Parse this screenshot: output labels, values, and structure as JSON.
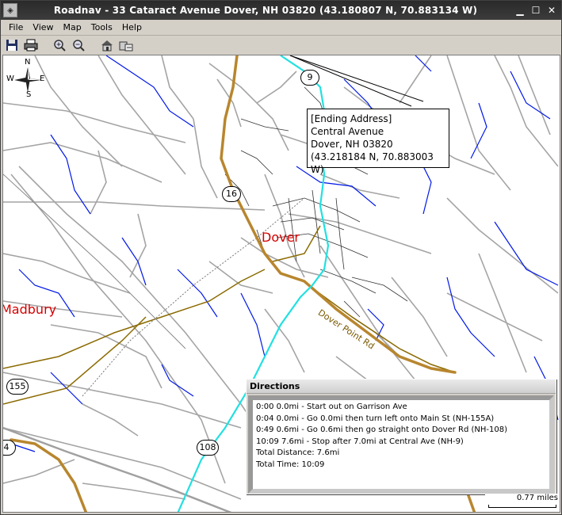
{
  "window": {
    "title": "Roadnav - 33 Cataract Avenue Dover, NH 03820 (43.180807 N, 70.883134 W)",
    "app_icon": "roadnav-app-icon",
    "controls": [
      "minimize-icon",
      "maximize-icon",
      "close-icon"
    ]
  },
  "menu": {
    "items": [
      {
        "label": "File",
        "icon": ""
      },
      {
        "label": "View",
        "icon": ""
      },
      {
        "label": "Map",
        "icon": ""
      },
      {
        "label": "Tools",
        "icon": ""
      },
      {
        "label": "Help",
        "icon": ""
      }
    ]
  },
  "toolbar": {
    "buttons": [
      "save-icon",
      "print-icon",
      "zoom-in-icon",
      "zoom-out-icon",
      "home-icon",
      "route-icon"
    ]
  },
  "map": {
    "compass": {
      "n": "N",
      "s": "S",
      "e": "E",
      "w": "W"
    },
    "towns": [
      {
        "name": "Dover"
      },
      {
        "name": "Madbury"
      }
    ],
    "route_shields": [
      "9",
      "16",
      "155",
      "108",
      "4"
    ],
    "road_labels": [
      "Dover Point Rd"
    ],
    "callout": {
      "line1": "[Ending Address]",
      "line2": "Central Avenue",
      "line3": "Dover, NH 03820",
      "line4": "(43.218184 N, 70.883003 W)"
    },
    "scale": "0.77 miles",
    "colors": {
      "route": "#22e0e0",
      "highway": "#b8862e",
      "water": "#0000e0",
      "road": "#a0a0a0",
      "secondary": "#8b6a00"
    }
  },
  "directions": {
    "title": "Directions",
    "lines": [
      "0:00 0.0mi - Start out on Garrison Ave",
      "0:04 0.0mi - Go 0.0mi then turn left onto Main St (NH-155A)",
      "0:49 0.6mi - Go 0.6mi then go straight onto Dover Rd (NH-108)",
      "10:09 7.6mi - Stop after 7.0mi at Central Ave (NH-9)",
      "Total Distance: 7.6mi",
      "Total Time: 10:09"
    ]
  }
}
